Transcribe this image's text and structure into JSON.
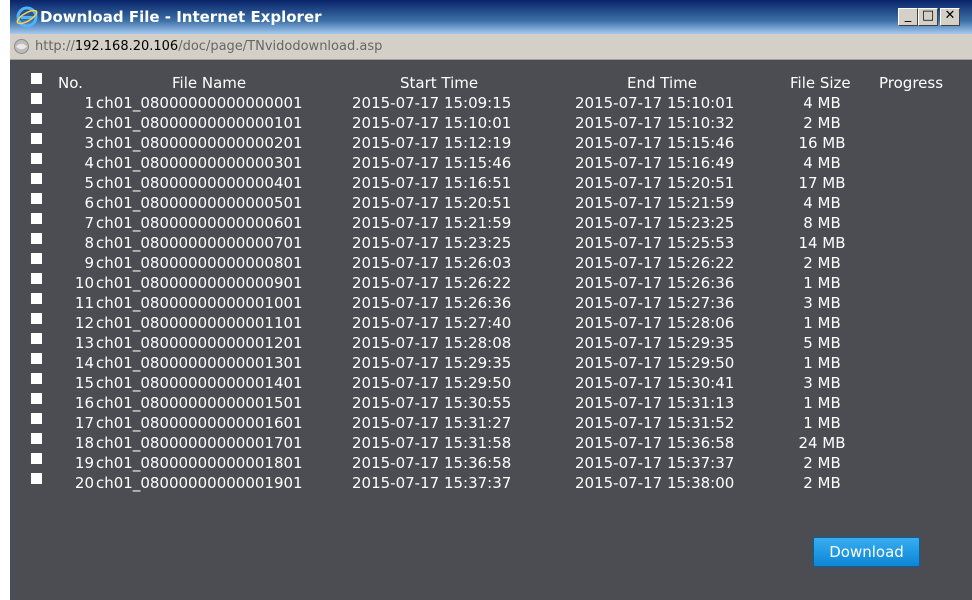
{
  "window": {
    "title": "Download File - Internet Explorer",
    "controls": [
      "_",
      "□",
      "✕"
    ]
  },
  "address": {
    "prefix": "http://",
    "host": "192.168.20.106",
    "path": "/doc/page/TNvidodownload.asp"
  },
  "table": {
    "headers": {
      "no": "No.",
      "file_name": "File Name",
      "start_time": "Start Time",
      "end_time": "End Time",
      "file_size": "File Size",
      "progress": "Progress"
    },
    "rows": [
      {
        "no": "1",
        "name": "ch01_08000000000000001",
        "start": "2015-07-17 15:09:15",
        "end": "2015-07-17 15:10:01",
        "size": "4 MB"
      },
      {
        "no": "2",
        "name": "ch01_08000000000000101",
        "start": "2015-07-17 15:10:01",
        "end": "2015-07-17 15:10:32",
        "size": "2 MB"
      },
      {
        "no": "3",
        "name": "ch01_08000000000000201",
        "start": "2015-07-17 15:12:19",
        "end": "2015-07-17 15:15:46",
        "size": "16 MB"
      },
      {
        "no": "4",
        "name": "ch01_08000000000000301",
        "start": "2015-07-17 15:15:46",
        "end": "2015-07-17 15:16:49",
        "size": "4 MB"
      },
      {
        "no": "5",
        "name": "ch01_08000000000000401",
        "start": "2015-07-17 15:16:51",
        "end": "2015-07-17 15:20:51",
        "size": "17 MB"
      },
      {
        "no": "6",
        "name": "ch01_08000000000000501",
        "start": "2015-07-17 15:20:51",
        "end": "2015-07-17 15:21:59",
        "size": "4 MB"
      },
      {
        "no": "7",
        "name": "ch01_08000000000000601",
        "start": "2015-07-17 15:21:59",
        "end": "2015-07-17 15:23:25",
        "size": "8 MB"
      },
      {
        "no": "8",
        "name": "ch01_08000000000000701",
        "start": "2015-07-17 15:23:25",
        "end": "2015-07-17 15:25:53",
        "size": "14 MB"
      },
      {
        "no": "9",
        "name": "ch01_08000000000000801",
        "start": "2015-07-17 15:26:03",
        "end": "2015-07-17 15:26:22",
        "size": "2 MB"
      },
      {
        "no": "10",
        "name": "ch01_08000000000000901",
        "start": "2015-07-17 15:26:22",
        "end": "2015-07-17 15:26:36",
        "size": "1 MB"
      },
      {
        "no": "11",
        "name": "ch01_08000000000001001",
        "start": "2015-07-17 15:26:36",
        "end": "2015-07-17 15:27:36",
        "size": "3 MB"
      },
      {
        "no": "12",
        "name": "ch01_08000000000001101",
        "start": "2015-07-17 15:27:40",
        "end": "2015-07-17 15:28:06",
        "size": "1 MB"
      },
      {
        "no": "13",
        "name": "ch01_08000000000001201",
        "start": "2015-07-17 15:28:08",
        "end": "2015-07-17 15:29:35",
        "size": "5 MB"
      },
      {
        "no": "14",
        "name": "ch01_08000000000001301",
        "start": "2015-07-17 15:29:35",
        "end": "2015-07-17 15:29:50",
        "size": "1 MB"
      },
      {
        "no": "15",
        "name": "ch01_08000000000001401",
        "start": "2015-07-17 15:29:50",
        "end": "2015-07-17 15:30:41",
        "size": "3 MB"
      },
      {
        "no": "16",
        "name": "ch01_08000000000001501",
        "start": "2015-07-17 15:30:55",
        "end": "2015-07-17 15:31:13",
        "size": "1 MB"
      },
      {
        "no": "17",
        "name": "ch01_08000000000001601",
        "start": "2015-07-17 15:31:27",
        "end": "2015-07-17 15:31:52",
        "size": "1 MB"
      },
      {
        "no": "18",
        "name": "ch01_08000000000001701",
        "start": "2015-07-17 15:31:58",
        "end": "2015-07-17 15:36:58",
        "size": "24 MB"
      },
      {
        "no": "19",
        "name": "ch01_08000000000001801",
        "start": "2015-07-17 15:36:58",
        "end": "2015-07-17 15:37:37",
        "size": "2 MB"
      },
      {
        "no": "20",
        "name": "ch01_08000000000001901",
        "start": "2015-07-17 15:37:37",
        "end": "2015-07-17 15:38:00",
        "size": "2 MB"
      }
    ]
  },
  "actions": {
    "download_label": "Download"
  },
  "colors": {
    "background": "#4b4d52",
    "text": "#ffffff",
    "button": "#1b95e0",
    "titlebar": "#0a246a"
  },
  "icons": {
    "title": "ie-logo-icon",
    "address": "page-globe-icon"
  }
}
